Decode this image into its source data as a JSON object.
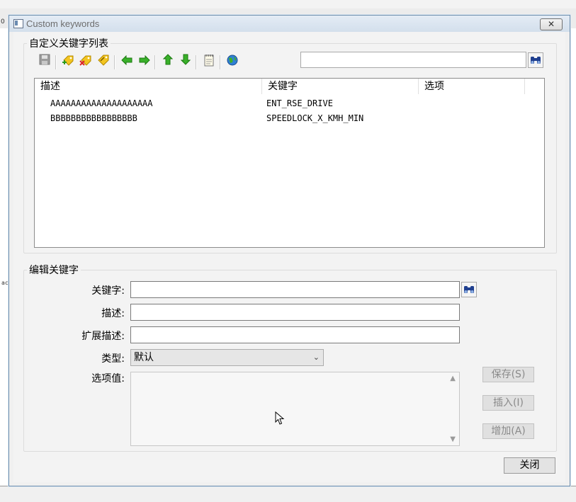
{
  "window": {
    "title": "Custom keywords",
    "close_label": "✕"
  },
  "background": {
    "left_fragment": "ac",
    "top_fragment": "0"
  },
  "list_group": {
    "legend": "自定义关键字列表",
    "toolbar_icons": [
      "save-icon",
      "add-key-icon",
      "delete-key-icon",
      "edit-tag-icon",
      "arrow-left-icon",
      "arrow-right-icon",
      "arrow-up-icon",
      "arrow-down-icon",
      "notepad-icon",
      "globe-icon"
    ],
    "search_value": "",
    "columns": [
      "描述",
      "关键字",
      "选项"
    ],
    "rows": [
      {
        "desc": "AAAAAAAAAAAAAAAAAAAA",
        "keyword": "ENT_RSE_DRIVE",
        "option": ""
      },
      {
        "desc": "BBBBBBBBBBBBBBBBB",
        "keyword": "SPEEDLOCK_X_KMH_MIN",
        "option": ""
      }
    ]
  },
  "edit_group": {
    "legend": "编辑关键字",
    "keyword_label": "关键字:",
    "desc_label": "描述:",
    "ext_desc_label": "扩展描述:",
    "type_label": "类型:",
    "type_value": "默认",
    "options_label": "选项值:",
    "keyword_value": "",
    "desc_value": "",
    "ext_desc_value": "",
    "save_label": "保存(S)",
    "insert_label": "插入(I)",
    "add_label": "增加(A)"
  },
  "close_button_label": "关闭",
  "colors": {
    "accent_green": "#2e9b1f",
    "accent_yellow": "#e8b400",
    "find_blue": "#1f3f8f"
  }
}
